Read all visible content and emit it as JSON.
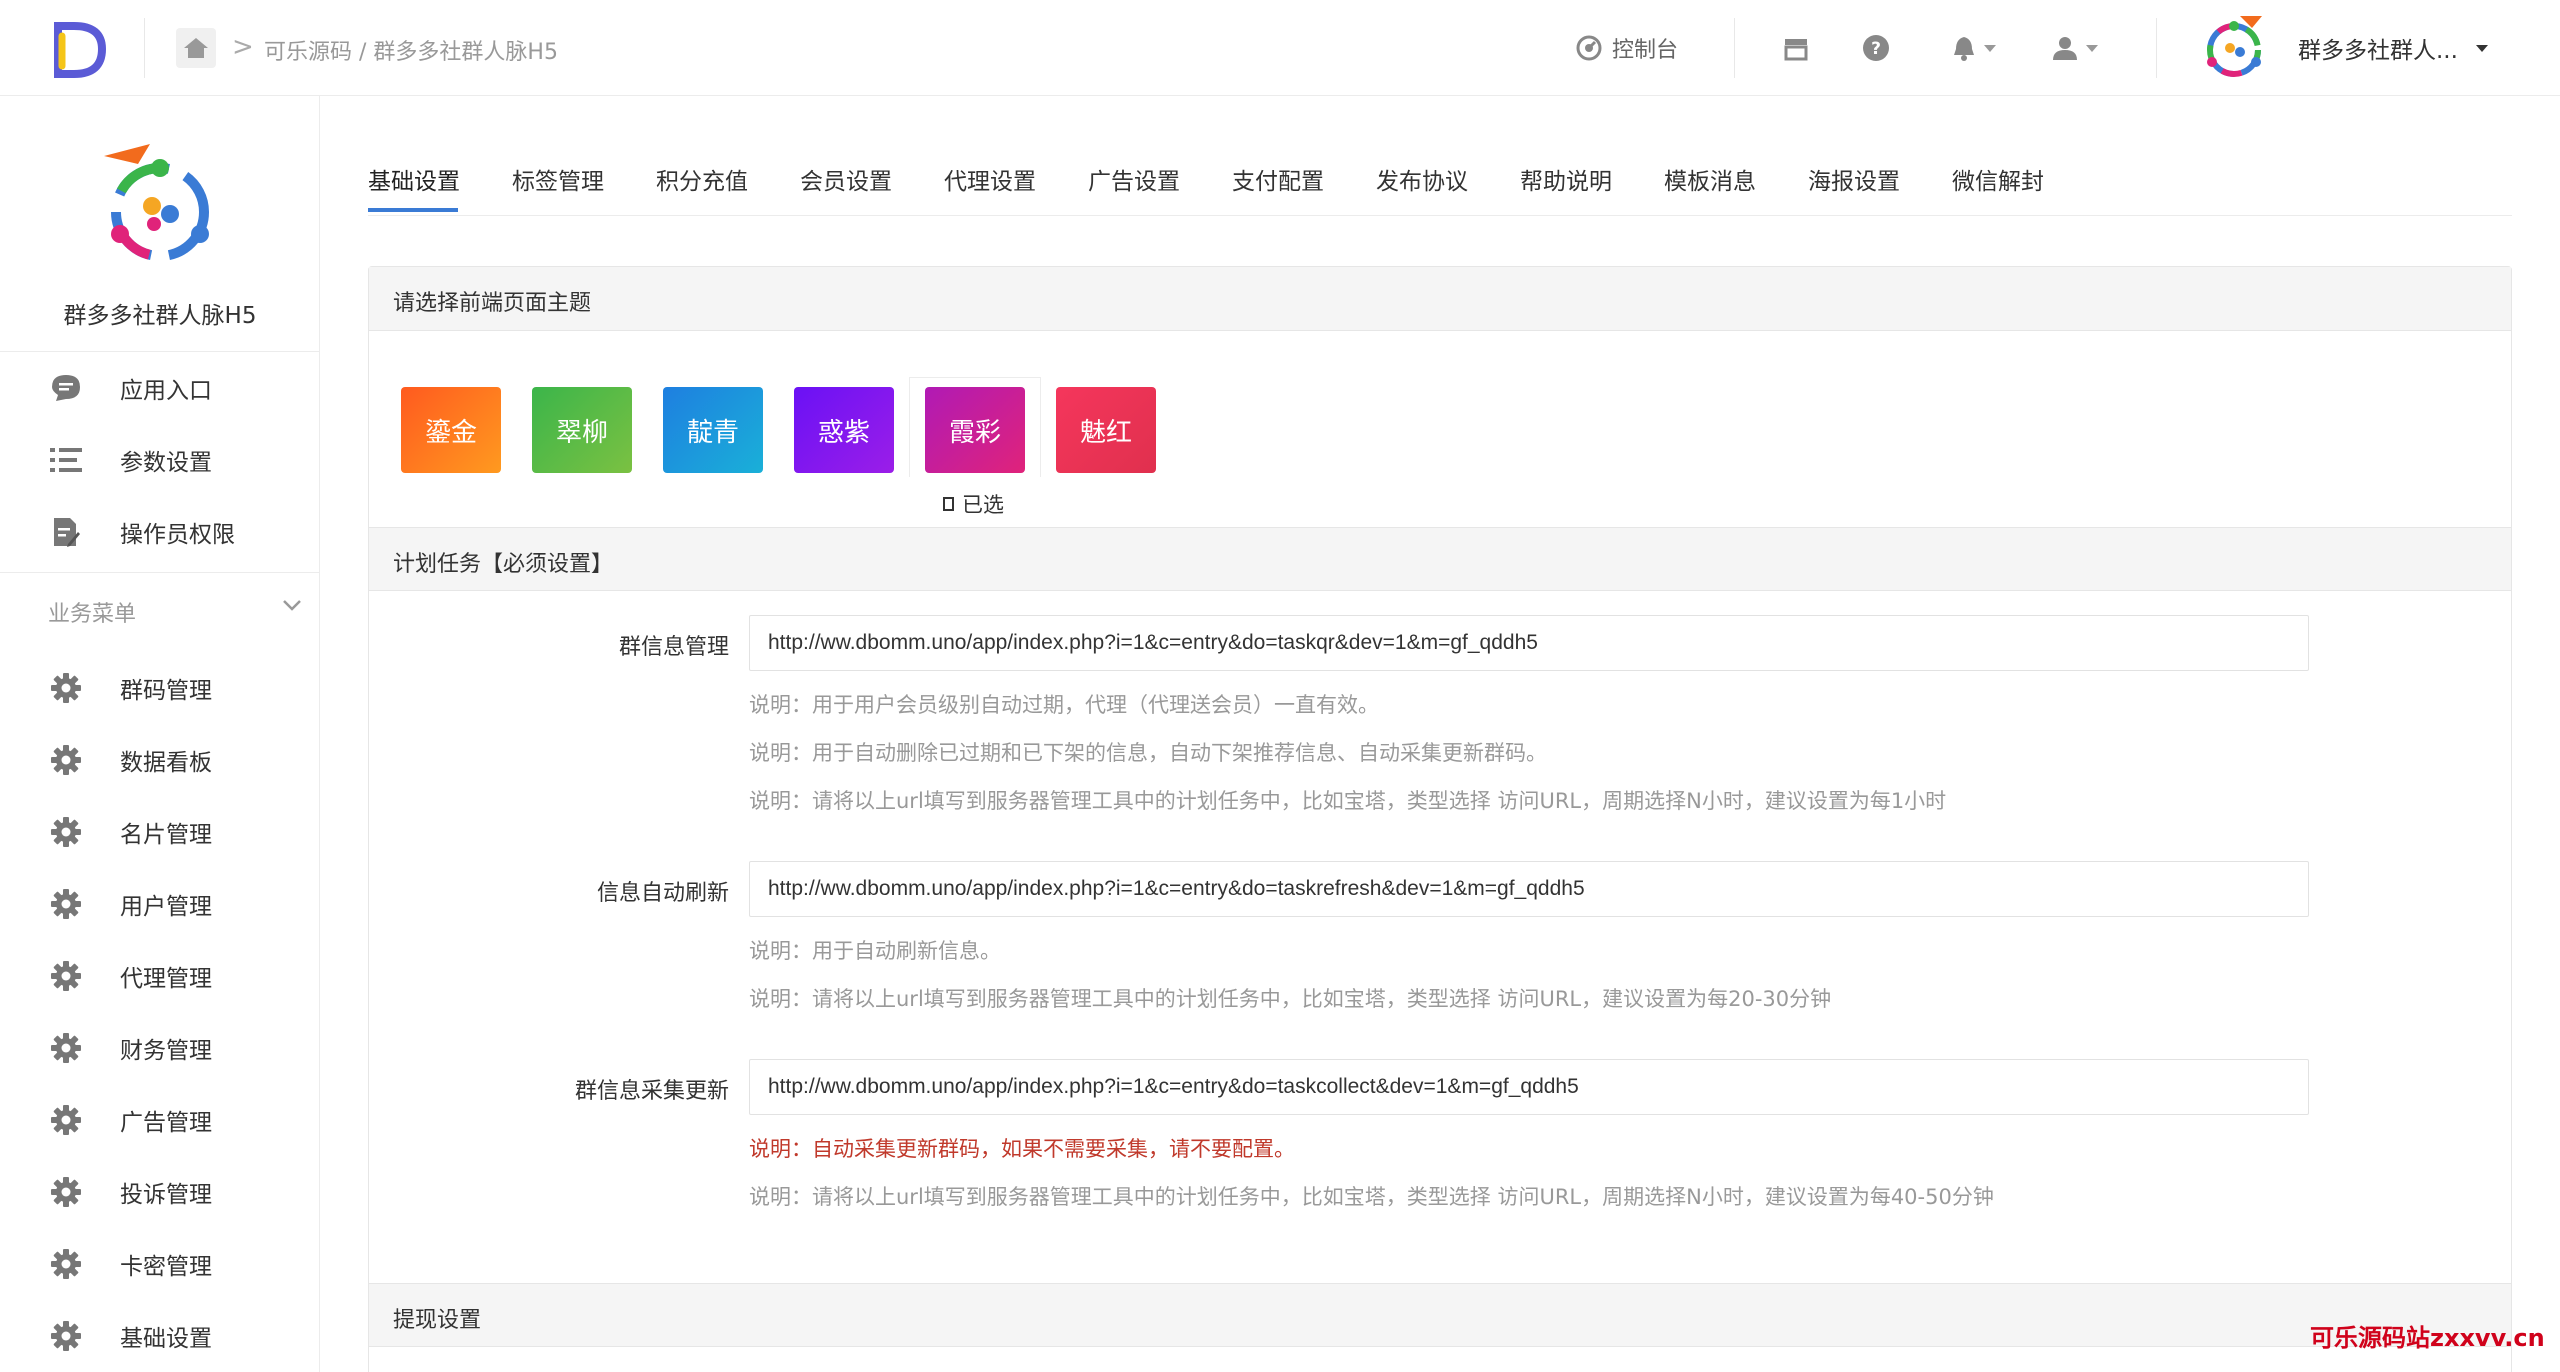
{
  "header": {
    "breadcrumb": "可乐源码 / 群多多社群人脉H5",
    "breadcrumb_sep": ">",
    "console_label": "控制台",
    "user_name": "群多多社群人..."
  },
  "sidebar": {
    "app_title": "群多多社群人脉H5",
    "top_items": [
      {
        "label": "应用入口",
        "icon": "chat-icon"
      },
      {
        "label": "参数设置",
        "icon": "list-icon"
      },
      {
        "label": "操作员权限",
        "icon": "document-edit-icon"
      }
    ],
    "group_label": "业务菜单",
    "group_items": [
      {
        "label": "群码管理"
      },
      {
        "label": "数据看板"
      },
      {
        "label": "名片管理"
      },
      {
        "label": "用户管理"
      },
      {
        "label": "代理管理"
      },
      {
        "label": "财务管理"
      },
      {
        "label": "广告管理"
      },
      {
        "label": "投诉管理"
      },
      {
        "label": "卡密管理"
      },
      {
        "label": "基础设置"
      }
    ]
  },
  "tabs": [
    "基础设置",
    "标签管理",
    "积分充值",
    "会员设置",
    "代理设置",
    "广告设置",
    "支付配置",
    "发布协议",
    "帮助说明",
    "模板消息",
    "海报设置",
    "微信解封"
  ],
  "active_tab": "基础设置",
  "theme_section": {
    "title": "请选择前端页面主题",
    "themes": [
      {
        "label": "鎏金",
        "from": "#ff5a1f",
        "to": "#ff9a1f"
      },
      {
        "label": "翠柳",
        "from": "#3bb54a",
        "to": "#7bc142"
      },
      {
        "label": "靛青",
        "from": "#1e7fe0",
        "to": "#1ab0d8"
      },
      {
        "label": "惑紫",
        "from": "#6a11f5",
        "to": "#9b1ee8"
      },
      {
        "label": "霞彩",
        "from": "#b01ab5",
        "to": "#e0237a"
      },
      {
        "label": "魅红",
        "from": "#f5365c",
        "to": "#e0304e"
      }
    ],
    "selected_label": "已选"
  },
  "cron_section": {
    "title": "计划任务【必须设置】",
    "rows": [
      {
        "label": "群信息管理",
        "url": "http://ww.dbomm.uno/app/index.php?i=1&c=entry&do=taskqr&dev=1&m=gf_qddh5",
        "notes": [
          "说明：用于用户会员级别自动过期，代理（代理送会员）一直有效。",
          "说明：用于自动删除已过期和已下架的信息，自动下架推荐信息、自动采集更新群码。",
          "说明：请将以上url填写到服务器管理工具中的计划任务中，比如宝塔，类型选择 访问URL，周期选择N小时，建议设置为每1小时"
        ]
      },
      {
        "label": "信息自动刷新",
        "url": "http://ww.dbomm.uno/app/index.php?i=1&c=entry&do=taskrefresh&dev=1&m=gf_qddh5",
        "notes": [
          "说明：用于自动刷新信息。",
          "说明：请将以上url填写到服务器管理工具中的计划任务中，比如宝塔，类型选择 访问URL，建议设置为每20-30分钟"
        ]
      },
      {
        "label": "群信息采集更新",
        "url": "http://ww.dbomm.uno/app/index.php?i=1&c=entry&do=taskcollect&dev=1&m=gf_qddh5",
        "notes": [
          "说明：自动采集更新群码，如果不需要采集，请不要配置。",
          "说明：请将以上url填写到服务器管理工具中的计划任务中，比如宝塔，类型选择 访问URL，周期选择N小时，建议设置为每40-50分钟"
        ],
        "warning_color": "#c0392b"
      }
    ]
  },
  "withdraw_section": {
    "title": "提现设置"
  },
  "watermark": "可乐源码站zxxvv.cn",
  "colors": {
    "accent": "#3a7bd5",
    "warning": "#c0392b"
  }
}
